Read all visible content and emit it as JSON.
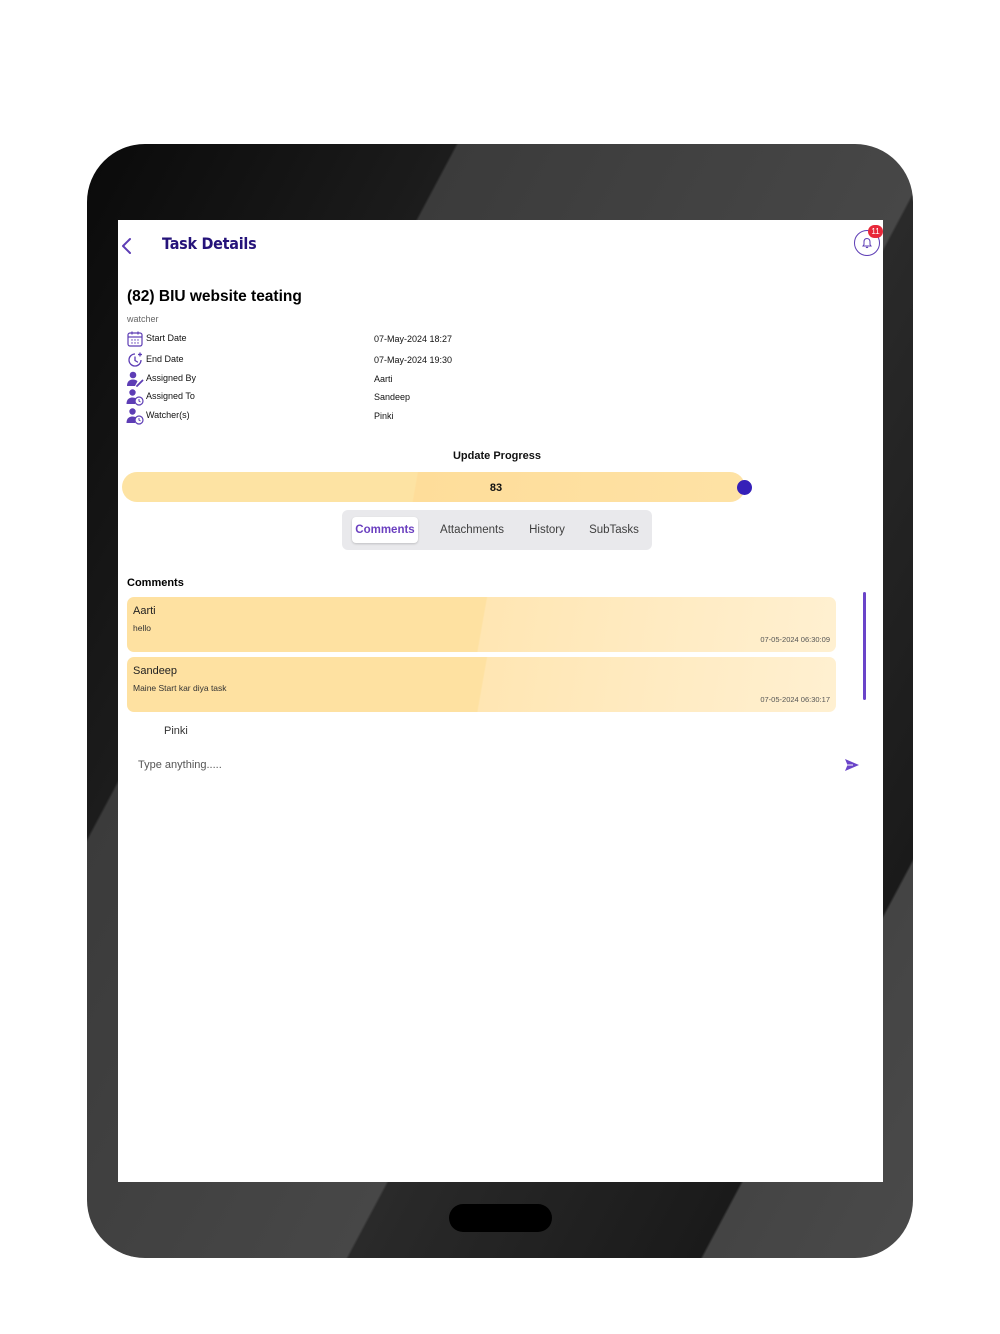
{
  "header": {
    "title": "Task Details",
    "notification_count": "11"
  },
  "task": {
    "title": "(82) BIU website teating",
    "role_label": "watcher",
    "details": [
      {
        "label": "Start Date",
        "value": "07-May-2024 18:27",
        "icon": "calendar-icon"
      },
      {
        "label": "End Date",
        "value": "07-May-2024 19:30",
        "icon": "clock-icon"
      },
      {
        "label": "Assigned By",
        "value": "Aarti",
        "icon": "user-edit-icon"
      },
      {
        "label": "Assigned To",
        "value": "Sandeep",
        "icon": "user-clock-icon"
      },
      {
        "label": "Watcher(s)",
        "value": "Pinki",
        "icon": "user-clock-icon"
      }
    ]
  },
  "progress": {
    "label": "Update Progress",
    "value": "83",
    "fraction": 0.83
  },
  "tabs": [
    {
      "label": "Comments",
      "active": true
    },
    {
      "label": "Attachments",
      "active": false
    },
    {
      "label": "History",
      "active": false
    },
    {
      "label": "SubTasks",
      "active": false
    }
  ],
  "comments": {
    "heading": "Comments",
    "items": [
      {
        "author": "Aarti",
        "text": "hello",
        "time": "07-05-2024 06:30:09"
      },
      {
        "author": "Sandeep",
        "text": "Maine Start kar diya task",
        "time": "07-05-2024 06:30:17"
      }
    ],
    "current_user": "Pinki",
    "input_placeholder": "Type anything....."
  },
  "colors": {
    "accent": "#25137a",
    "slider_thumb": "#3520b8",
    "comment_bg": "#fee1a1",
    "badge": "#e8283a",
    "active_tab": "#6a3fbf"
  }
}
